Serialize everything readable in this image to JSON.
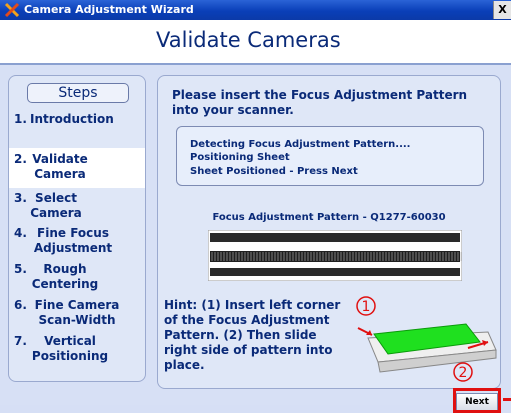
{
  "window": {
    "title": "Camera Adjustment Wizard",
    "close_label": "X"
  },
  "header": {
    "title": "Validate Cameras"
  },
  "steps": {
    "title": "Steps",
    "items": [
      {
        "num": "1.",
        "label": "Introduction"
      },
      {
        "num": "2.",
        "label": "Validate Camera"
      },
      {
        "num": "3.",
        "label": "Select Camera"
      },
      {
        "num": "4.",
        "label": "Fine Focus Adjustment"
      },
      {
        "num": "5.",
        "label": "Rough Centering"
      },
      {
        "num": "6.",
        "label": "Fine Camera Scan-Width"
      },
      {
        "num": "7.",
        "label": "Vertical Positioning"
      }
    ],
    "active_index": 1
  },
  "main": {
    "instruction": "Please insert the Focus Adjustment Pattern into your scanner.",
    "status_lines": [
      "Detecting Focus Adjustment Pattern....",
      "Positioning Sheet",
      "Sheet Positioned - Press Next"
    ],
    "pattern_label": "Focus Adjustment Pattern - Q1277-60030",
    "hint": "Hint: (1) Insert left corner of the Focus Adjustment Pattern. (2) Then slide right side of pattern into place.",
    "marker_1": "1",
    "marker_2": "2"
  },
  "buttons": {
    "next": "Next"
  },
  "colors": {
    "title_blue": "#0a2a78",
    "highlight_red": "#e01010",
    "pattern_green": "#17e617"
  }
}
